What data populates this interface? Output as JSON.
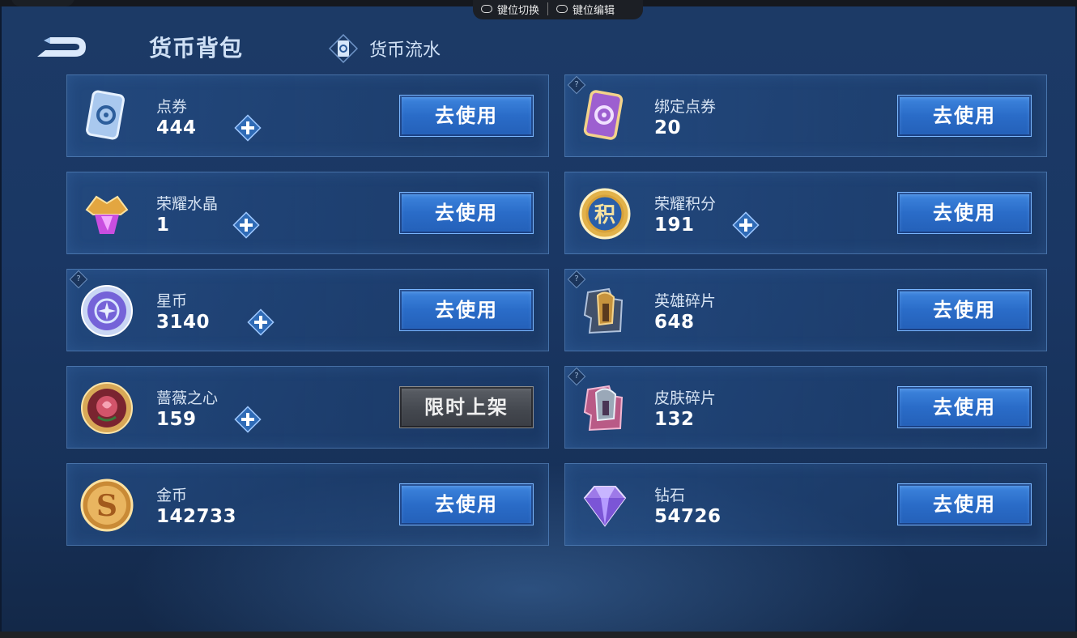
{
  "header": {
    "title": "货币背包",
    "flow_label": "货币流水"
  },
  "keybar": {
    "switch_label": "键位切换",
    "edit_label": "键位编辑"
  },
  "currencies": [
    {
      "name": "点券",
      "amount": "444",
      "button": "去使用",
      "plus": true,
      "help": false,
      "icon": "coupon-icon"
    },
    {
      "name": "绑定点券",
      "amount": "20",
      "button": "去使用",
      "plus": false,
      "help": true,
      "icon": "bound-coupon-icon"
    },
    {
      "name": "荣耀水晶",
      "amount": "1",
      "button": "去使用",
      "plus": true,
      "help": false,
      "icon": "glory-crystal-icon"
    },
    {
      "name": "荣耀积分",
      "amount": "191",
      "button": "去使用",
      "plus": true,
      "help": false,
      "icon": "glory-points-icon"
    },
    {
      "name": "星币",
      "amount": "3140",
      "button": "去使用",
      "plus": true,
      "help": true,
      "icon": "star-coin-icon"
    },
    {
      "name": "英雄碎片",
      "amount": "648",
      "button": "去使用",
      "plus": false,
      "help": true,
      "icon": "hero-fragment-icon"
    },
    {
      "name": "蔷薇之心",
      "amount": "159",
      "button": "限时上架",
      "plus": true,
      "help": false,
      "icon": "rose-heart-icon"
    },
    {
      "name": "皮肤碎片",
      "amount": "132",
      "button": "去使用",
      "plus": false,
      "help": true,
      "icon": "skin-fragment-icon"
    },
    {
      "name": "金币",
      "amount": "142733",
      "button": "去使用",
      "plus": false,
      "help": false,
      "icon": "gold-coin-icon"
    },
    {
      "name": "钻石",
      "amount": "54726",
      "button": "去使用",
      "plus": false,
      "help": false,
      "icon": "diamond-icon"
    }
  ],
  "colors": {
    "accent_button": "#2a6cc8",
    "disabled_button": "#43474e"
  }
}
